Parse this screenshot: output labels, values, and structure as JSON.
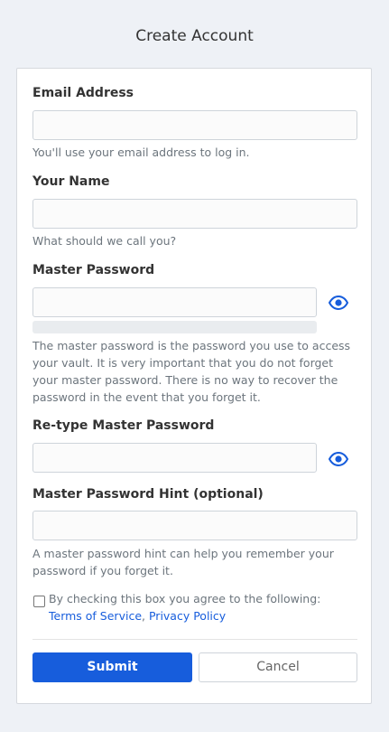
{
  "page": {
    "title": "Create Account"
  },
  "form": {
    "email": {
      "label": "Email Address",
      "value": "",
      "help": "You'll use your email address to log in."
    },
    "name": {
      "label": "Your Name",
      "value": "",
      "help": "What should we call you?"
    },
    "master_password": {
      "label": "Master Password",
      "value": "",
      "strength": 0,
      "help": "The master password is the password you use to access your vault. It is very important that you do not forget your master password. There is no way to recover the password in the event that you forget it."
    },
    "retype_password": {
      "label": "Re-type Master Password",
      "value": ""
    },
    "hint": {
      "label": "Master Password Hint (optional)",
      "value": "",
      "help": "A master password hint can help you remember your password if you forget it."
    },
    "agree": {
      "checked": false,
      "text": "By checking this box you agree to the following:",
      "terms_link": "Terms of Service",
      "separator": ",",
      "privacy_link": "Privacy Policy"
    },
    "buttons": {
      "submit": "Submit",
      "cancel": "Cancel"
    }
  },
  "icons": {
    "toggle_visibility": "eye-icon"
  },
  "colors": {
    "accent": "#175ddc",
    "background": "#eef1f6",
    "help_text": "#6c757d"
  }
}
